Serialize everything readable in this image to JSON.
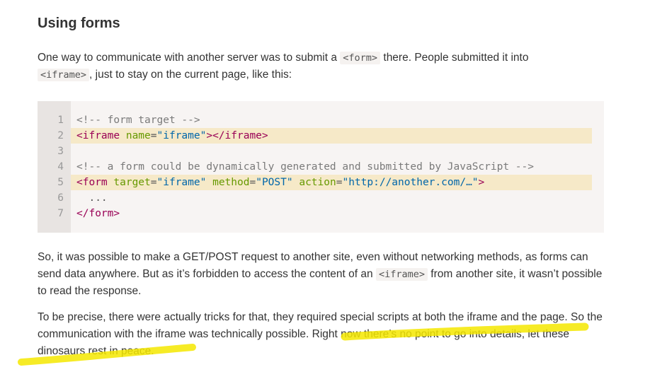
{
  "heading": "Using forms",
  "p1": {
    "t1": "One way to communicate with another server was to submit a ",
    "code1": "<form>",
    "t2": " there. People submitted it into ",
    "code2": "<iframe>",
    "t3": ", just to stay on the current page, like this:"
  },
  "code_lines": [
    {
      "num": "1",
      "highlight": false,
      "tokens": [
        {
          "type": "comment",
          "text": "<!-- form target -->"
        }
      ]
    },
    {
      "num": "2",
      "highlight": true,
      "tokens": [
        {
          "type": "tag",
          "text": "<iframe "
        },
        {
          "type": "attr",
          "text": "name"
        },
        {
          "type": "plain",
          "text": "="
        },
        {
          "type": "str",
          "text": "\"iframe\""
        },
        {
          "type": "tag",
          "text": "></iframe>"
        }
      ]
    },
    {
      "num": "3",
      "highlight": false,
      "tokens": []
    },
    {
      "num": "4",
      "highlight": false,
      "tokens": [
        {
          "type": "comment",
          "text": "<!-- a form could be dynamically generated and submitted by JavaScript -->"
        }
      ]
    },
    {
      "num": "5",
      "highlight": true,
      "tokens": [
        {
          "type": "tag",
          "text": "<form "
        },
        {
          "type": "attr",
          "text": "target"
        },
        {
          "type": "plain",
          "text": "="
        },
        {
          "type": "str",
          "text": "\"iframe\""
        },
        {
          "type": "plain",
          "text": " "
        },
        {
          "type": "attr",
          "text": "method"
        },
        {
          "type": "plain",
          "text": "="
        },
        {
          "type": "str",
          "text": "\"POST\""
        },
        {
          "type": "plain",
          "text": " "
        },
        {
          "type": "attr",
          "text": "action"
        },
        {
          "type": "plain",
          "text": "="
        },
        {
          "type": "str",
          "text": "\"http://another.com/…\""
        },
        {
          "type": "tag",
          "text": ">"
        }
      ]
    },
    {
      "num": "6",
      "highlight": false,
      "tokens": [
        {
          "type": "plain",
          "text": "  ..."
        }
      ]
    },
    {
      "num": "7",
      "highlight": false,
      "tokens": [
        {
          "type": "tag",
          "text": "</form>"
        }
      ]
    }
  ],
  "p2": {
    "t1": "So, it was possible to make a GET/POST request to another site, even without networking methods, as forms can send data anywhere. But as it’s forbidden to access the content of an ",
    "code1": "<iframe>",
    "t2": " from another site, it wasn’t possible to read the response."
  },
  "p3": {
    "text": "To be precise, there were actually tricks for that, they required special scripts at both the iframe and the page. So the communication with the iframe was technically possible. Right now there’s no point to go into details, let these dinosaurs rest in peace."
  },
  "colors": {
    "highlighter": "#f5e800",
    "code_bg": "#f7f4f3",
    "line_highlight": "#f6e9c8"
  }
}
